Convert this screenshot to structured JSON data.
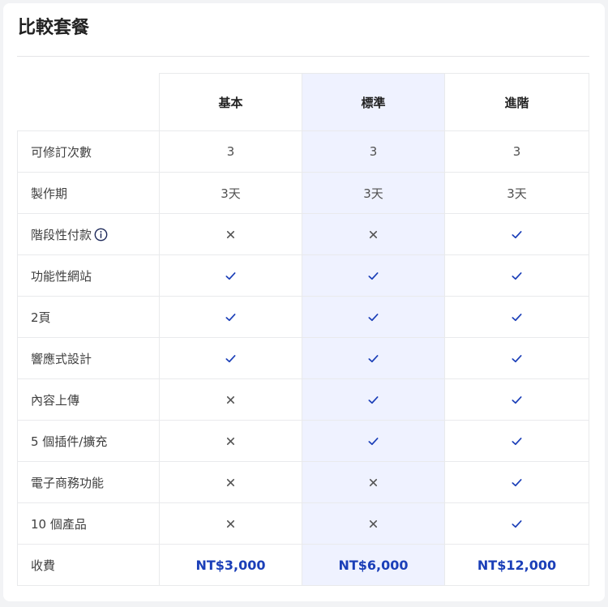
{
  "title": "比較套餐",
  "plans": [
    {
      "name": "基本",
      "price": "NT$3,000"
    },
    {
      "name": "標準",
      "price": "NT$6,000"
    },
    {
      "name": "進階",
      "price": "NT$12,000"
    }
  ],
  "rows": [
    {
      "label": "可修訂次數",
      "type": "text",
      "values": [
        "3",
        "3",
        "3"
      ]
    },
    {
      "label": "製作期",
      "type": "text",
      "values": [
        "3天",
        "3天",
        "3天"
      ]
    },
    {
      "label": "階段性付款",
      "type": "bool",
      "info": true,
      "values": [
        false,
        false,
        true
      ]
    },
    {
      "label": "功能性網站",
      "type": "bool",
      "values": [
        true,
        true,
        true
      ]
    },
    {
      "label": "2頁",
      "type": "bool",
      "values": [
        true,
        true,
        true
      ]
    },
    {
      "label": "響應式設計",
      "type": "bool",
      "values": [
        true,
        true,
        true
      ]
    },
    {
      "label": "內容上傳",
      "type": "bool",
      "values": [
        false,
        true,
        true
      ]
    },
    {
      "label": "5 個插件/擴充",
      "type": "bool",
      "values": [
        false,
        true,
        true
      ]
    },
    {
      "label": "電子商務功能",
      "type": "bool",
      "values": [
        false,
        false,
        true
      ]
    },
    {
      "label": "10 個產品",
      "type": "bool",
      "values": [
        false,
        false,
        true
      ]
    }
  ],
  "price_label": "收費",
  "highlight_plan": 1,
  "colors": {
    "accent": "#1b3fb8",
    "highlight": "#eff2ff",
    "cross": "#555555"
  }
}
